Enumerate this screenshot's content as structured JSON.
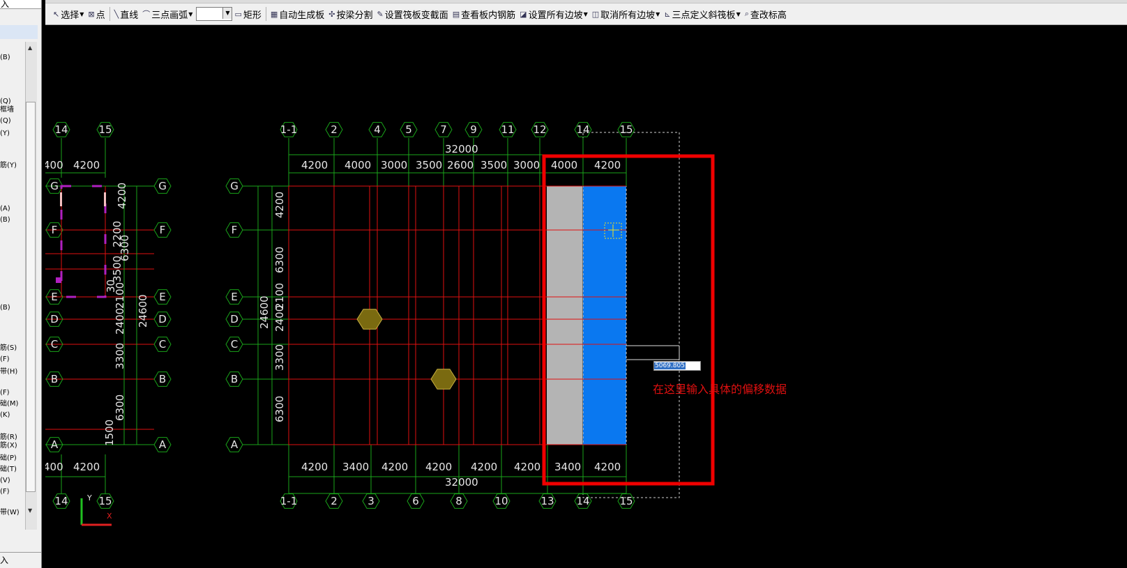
{
  "sidebar": {
    "top_label": "入",
    "bottom_label": "入",
    "items": [
      "(B)",
      "(Q)",
      "框墙",
      "(Q)",
      "(Y)",
      "筋(Y)",
      "(A)",
      "(B)",
      "(B)",
      "筋(S)",
      "(F)",
      "带(H)",
      "(F)",
      "础(M)",
      "(K)",
      "筋(R)",
      "筋(X)",
      "础(P)",
      "础(T)",
      "(V)",
      "(F)",
      "带(W)"
    ]
  },
  "toolbar": {
    "items": [
      {
        "label": "选择",
        "icon": "↖",
        "arrow": true
      },
      {
        "label": "点",
        "icon": "⊠"
      },
      {
        "label": "直线",
        "icon": "╲"
      },
      {
        "label": "三点画弧",
        "icon": "⌒",
        "arrow": true
      },
      {
        "label": "矩形",
        "icon": "▭"
      },
      {
        "label": "自动生成板",
        "icon": "▦"
      },
      {
        "label": "按梁分割",
        "icon": "✣"
      },
      {
        "label": "设置筏板变截面",
        "icon": "✎"
      },
      {
        "label": "查看板内钢筋",
        "icon": "▤"
      },
      {
        "label": "设置所有边坡",
        "icon": "◪",
        "arrow": true
      },
      {
        "label": "取消所有边坡",
        "icon": "◫",
        "arrow": true
      },
      {
        "label": "三点定义斜筏板",
        "icon": "⊾",
        "arrow": true
      },
      {
        "label": "查改标高",
        "icon": "⌕"
      }
    ]
  },
  "drawing": {
    "left_view": {
      "top_axes": [
        "14",
        "15"
      ],
      "bottom_axes": [
        "14",
        "15"
      ],
      "top_dims": [
        "400",
        "4200"
      ],
      "bottom_dims": [
        "400",
        "4200"
      ],
      "row_axes": [
        "G",
        "F",
        "E",
        "D",
        "C",
        "B",
        "A"
      ],
      "vertical_dims": [
        "4200",
        "2200",
        "6300",
        "3500",
        "30",
        "2100",
        "2400",
        "3300",
        "6300",
        "1500"
      ],
      "total_dim": "24600"
    },
    "main_view": {
      "top_axes": [
        "1-1",
        "2",
        "4",
        "5",
        "7",
        "9",
        "11",
        "12",
        "14",
        "15"
      ],
      "bottom_axes": [
        "1-1",
        "2",
        "3",
        "6",
        "8",
        "10",
        "13",
        "14",
        "15"
      ],
      "top_total": "32000",
      "bottom_total": "32000",
      "top_dims": [
        "4200",
        "4000",
        "3000",
        "3500",
        "2600",
        "3500",
        "3000",
        "4000",
        "4200"
      ],
      "bottom_dims": [
        "4200",
        "3400",
        "4200",
        "4200",
        "4200",
        "4200",
        "3400",
        "4200"
      ],
      "row_axes": [
        "G",
        "F",
        "E",
        "D",
        "C",
        "B",
        "A"
      ],
      "vertical_dims": [
        "4200",
        "6300",
        "2100",
        "2400",
        "3300",
        "6300"
      ],
      "total_dim": "24600"
    },
    "coord_labels": {
      "y": "Y",
      "x": "X"
    }
  },
  "offset_input": {
    "value": "5069.805"
  },
  "annotation": {
    "text": "在这里输入具体的偏移数据"
  },
  "colors": {
    "grid_green": "#1aa51a",
    "grid_red": "#e01010",
    "slab_blue": "#0a78f0",
    "slab_gray": "#b4b4b4",
    "highlight_red": "#f00000",
    "column_olive": "#7a6a10"
  }
}
